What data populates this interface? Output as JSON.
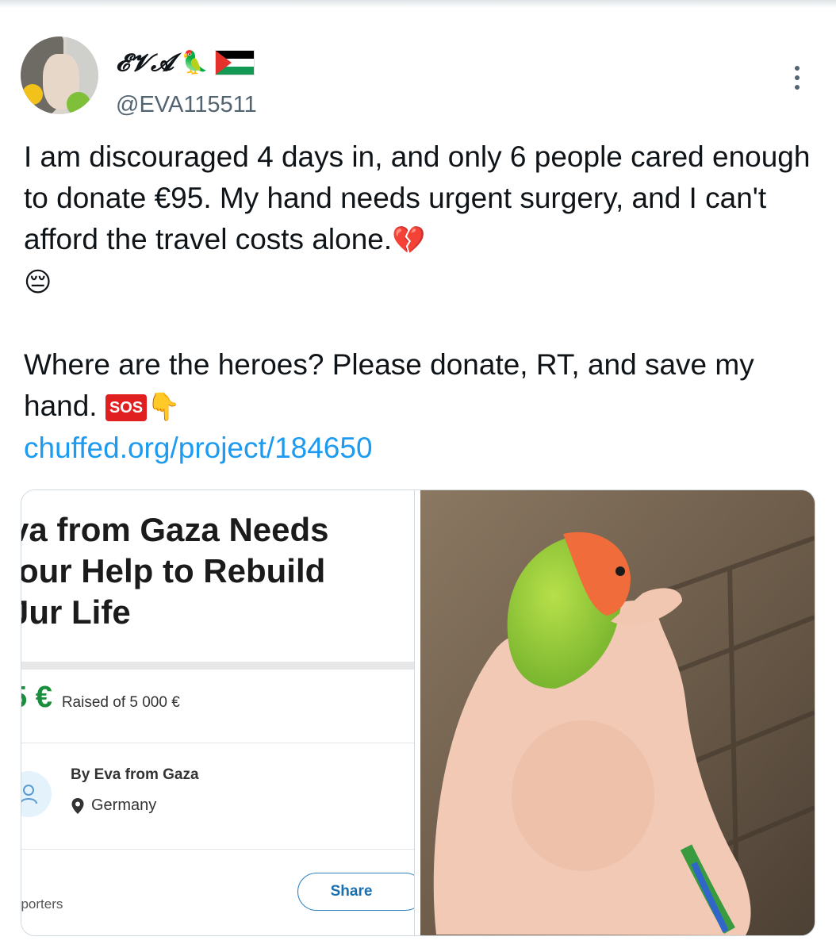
{
  "author": {
    "display_name": "𝓔𝓥𝓐",
    "parrot_emoji": "🦜",
    "handle": "@EVA115511"
  },
  "tweet": {
    "paragraph1": "I am discouraged 4 days in, and only 6 people cared enough to donate €95. My hand needs urgent surgery, and I can't afford the travel costs alone.",
    "paragraph1_emoji": "💔",
    "paragraph1_emoji2": "😔",
    "paragraph2": "Where are the heroes? Please donate, RT, and save my hand.",
    "sos_label": "SOS",
    "paragraph2_emoji": "👇",
    "link": "chuffed.org/project/184650"
  },
  "campaign_card": {
    "title_line1": "va from Gaza Needs",
    "title_line2": "'our Help to Rebuild",
    "title_line3": "Jur Life",
    "raised_amount": "5 €",
    "raised_label": "Raised of 5 000 €",
    "by_label": "By Eva from Gaza",
    "location": "Germany",
    "supporters_label": "pporters",
    "share_label": "Share"
  },
  "colors": {
    "link": "#1d9bf0",
    "raised_green": "#1b8e3d",
    "share_blue": "#1a6fb0",
    "handle_gray": "#536471"
  },
  "icons": {
    "more": "more-vertical-icon",
    "location": "location-pin-icon",
    "user": "user-icon"
  }
}
